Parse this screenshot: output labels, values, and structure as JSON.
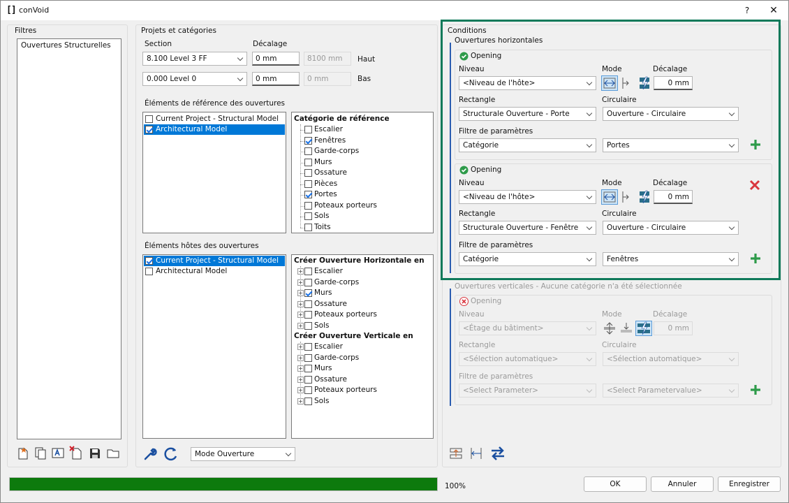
{
  "window": {
    "logo": "[]",
    "title": "conVoid",
    "help_label": "?",
    "close_label": "✕"
  },
  "filters": {
    "title": "Filtres",
    "items": [
      "Ouvertures Structurelles"
    ],
    "toolbar_icons": [
      "new-filter-icon",
      "copy-filter-icon",
      "edit-filter-icon",
      "delete-filter-icon",
      "save-filter-icon",
      "open-folder-icon"
    ]
  },
  "projects": {
    "title": "Projets et catégories",
    "section_label": "Section",
    "offset_label": "Décalage",
    "top": {
      "level": "8.100  Level 3 FF",
      "offset": "0 mm",
      "computed": "8100 mm",
      "side": "Haut"
    },
    "bottom": {
      "level": "0.000  Level 0",
      "offset": "0 mm",
      "computed": "0 mm",
      "side": "Bas"
    },
    "ref_title": "Éléments de référence des ouvertures",
    "ref_models": [
      {
        "label": "Current Project - Structural Model",
        "checked": false,
        "selected": false
      },
      {
        "label": "Architectural Model",
        "checked": true,
        "selected": true
      }
    ],
    "ref_cat_title": "Catégorie de référence",
    "ref_categories": [
      {
        "label": "Escalier",
        "checked": false
      },
      {
        "label": "Fenêtres",
        "checked": true
      },
      {
        "label": "Garde-corps",
        "checked": false
      },
      {
        "label": "Murs",
        "checked": false
      },
      {
        "label": "Ossature",
        "checked": false
      },
      {
        "label": "Pièces",
        "checked": false
      },
      {
        "label": "Portes",
        "checked": true
      },
      {
        "label": "Poteaux porteurs",
        "checked": false
      },
      {
        "label": "Sols",
        "checked": false
      },
      {
        "label": "Toits",
        "checked": false
      }
    ],
    "host_title": "Éléments hôtes des ouvertures",
    "host_models": [
      {
        "label": "Current Project - Structural Model",
        "checked": true,
        "selected": true
      },
      {
        "label": "Architectural Model",
        "checked": false,
        "selected": false
      }
    ],
    "host_h_title": "Créer Ouverture Horizontale en",
    "host_h": [
      {
        "label": "Escalier",
        "checked": false
      },
      {
        "label": "Garde-corps",
        "checked": false
      },
      {
        "label": "Murs",
        "checked": true
      },
      {
        "label": "Ossature",
        "checked": false
      },
      {
        "label": "Poteaux porteurs",
        "checked": false
      },
      {
        "label": "Sols",
        "checked": false
      }
    ],
    "host_v_title": "Créer Ouverture Verticale en",
    "host_v": [
      {
        "label": "Escalier",
        "checked": false
      },
      {
        "label": "Garde-corps",
        "checked": false
      },
      {
        "label": "Murs",
        "checked": false
      },
      {
        "label": "Ossature",
        "checked": false
      },
      {
        "label": "Poteaux porteurs",
        "checked": false
      },
      {
        "label": "Sols",
        "checked": false
      }
    ],
    "mode_select": "Mode Ouverture"
  },
  "conditions": {
    "title": "Conditions",
    "horizontal": {
      "title": "Ouvertures horizontales",
      "openings": [
        {
          "title": "Opening",
          "niveau_label": "Niveau",
          "niveau": "<Niveau de l'hôte>",
          "mode_label": "Mode",
          "offset_label": "Décalage",
          "offset": "0 mm",
          "rect_label": "Rectangle",
          "rect": "Structurale Ouverture - Porte",
          "circ_label": "Circulaire",
          "circ": "Ouverture - Circulaire",
          "filter_label": "Filtre de paramètres",
          "filter_param": "Catégorie",
          "filter_value": "Portes"
        },
        {
          "title": "Opening",
          "niveau_label": "Niveau",
          "niveau": "<Niveau de l'hôte>",
          "mode_label": "Mode",
          "offset_label": "Décalage",
          "offset": "0 mm",
          "rect_label": "Rectangle",
          "rect": "Structurale Ouverture - Fenêtre",
          "circ_label": "Circulaire",
          "circ": "Ouverture - Circulaire",
          "filter_label": "Filtre de paramètres",
          "filter_param": "Catégorie",
          "filter_value": "Fenêtres"
        }
      ]
    },
    "vertical": {
      "title": "Ouvertures verticales - Aucune catégorie n'a été sélectionnée",
      "opening": {
        "title": "Opening",
        "niveau_label": "Niveau",
        "niveau": "<Étage du bâtiment>",
        "mode_label": "Mode",
        "offset_label": "Décalage",
        "offset": "0 mm",
        "rect_label": "Rectangle",
        "rect": "<Sélection automatique>",
        "circ_label": "Circulaire",
        "circ": "<Sélection automatique>",
        "filter_label": "Filtre de paramètres",
        "filter_param": "<Select Parameter>",
        "filter_value": "<Select Parametervalue>"
      }
    },
    "highlight_color": "#0f7a5a"
  },
  "footer": {
    "progress": 100,
    "progress_label": "100%",
    "progress_color": "#0d7a0d",
    "ok": "OK",
    "cancel": "Annuler",
    "save": "Enregistrer"
  }
}
